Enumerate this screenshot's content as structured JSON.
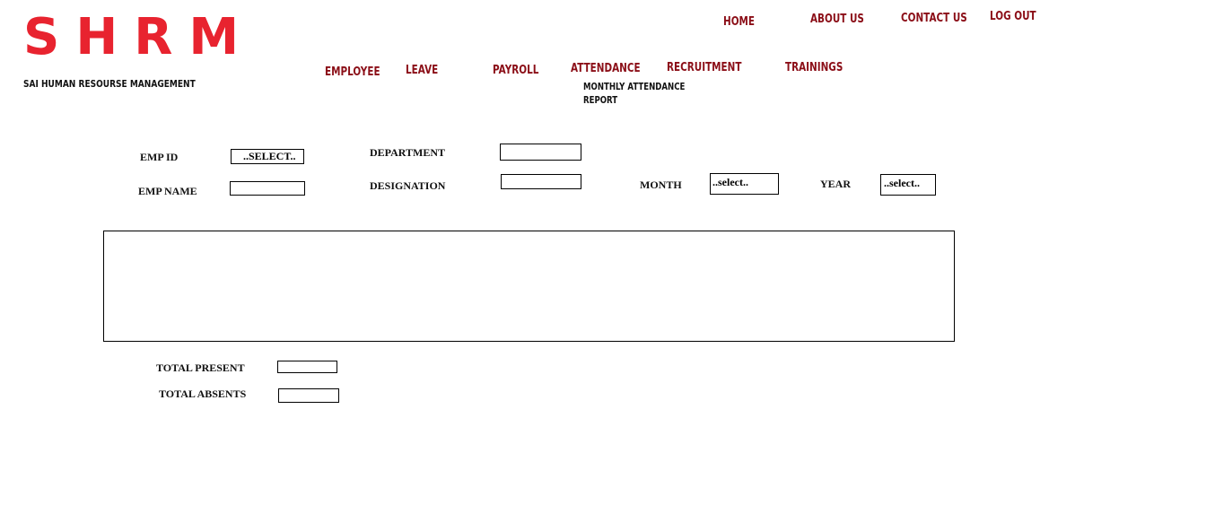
{
  "logo": {
    "title": "SHRM",
    "subtitle": "SAI HUMAN RESOURSE MANAGEMENT",
    "color": "#e8232f"
  },
  "top_nav": {
    "home": "HOME",
    "about": "ABOUT US",
    "contact": "CONTACT US",
    "logout": "LOG OUT"
  },
  "main_nav": {
    "employee": "EMPLOYEE",
    "leave": "LEAVE",
    "payroll": "PAYROLL",
    "attendance": "ATTENDANCE",
    "recruitment": "RECRUITMENT",
    "trainings": "TRAININGS",
    "attendance_submenu": "MONTHLY ATTENDANCE REPORT"
  },
  "form": {
    "emp_id_label": "EMP ID",
    "emp_id_value": "..SELECT..",
    "emp_name_label": "EMP NAME",
    "emp_name_value": "",
    "department_label": "DEPARTMENT",
    "department_value": "",
    "designation_label": "DESIGNATION",
    "designation_value": "",
    "month_label": "MONTH",
    "month_value": "..select..",
    "year_label": "YEAR",
    "year_value": "..select.."
  },
  "totals": {
    "present_label": "TOTAL PRESENT",
    "present_value": "",
    "absents_label": "TOTAL ABSENTS",
    "absents_value": ""
  },
  "colors": {
    "nav": "#8b0e17",
    "logo": "#e8232f"
  }
}
